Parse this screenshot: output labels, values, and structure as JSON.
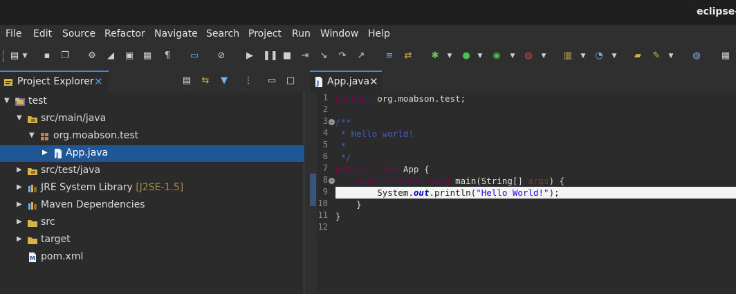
{
  "window": {
    "title": "eclipse-w"
  },
  "menu": [
    "File",
    "Edit",
    "Source",
    "Refactor",
    "Navigate",
    "Search",
    "Project",
    "Run",
    "Window",
    "Help"
  ],
  "toolbar_icons": [
    "new-icon",
    "save-icon",
    "save-all-icon",
    "properties-icon",
    "pencil-icon",
    "terminal-icon",
    "paragraph-icon",
    "toggle-icon",
    "skip-breakpoints-icon",
    "resume-icon",
    "suspend-icon",
    "terminate-icon",
    "step-into-icon",
    "step-over-icon",
    "step-return-icon",
    "drop-to-frame-icon",
    "debug-icon",
    "run-icon",
    "coverage-icon",
    "external-tools-icon",
    "new-java-project-icon",
    "new-class-icon",
    "open-type-icon",
    "search-icon",
    "globe-icon"
  ],
  "explorer": {
    "tab_label": "Project Explorer",
    "close": "✕",
    "tree": [
      {
        "label": "test",
        "decoration": ""
      },
      {
        "label": "src/main/java",
        "decoration": ""
      },
      {
        "label": "org.moabson.test",
        "decoration": ""
      },
      {
        "label": "App.java",
        "decoration": ""
      },
      {
        "label": "src/test/java",
        "decoration": ""
      },
      {
        "label": "JRE System Library ",
        "decoration": "[J2SE-1.5]"
      },
      {
        "label": "Maven Dependencies",
        "decoration": ""
      },
      {
        "label": "src",
        "decoration": ""
      },
      {
        "label": "target",
        "decoration": ""
      },
      {
        "label": "pom.xml",
        "decoration": ""
      }
    ]
  },
  "editor": {
    "tab_label": "App.java",
    "close": "✕",
    "line_numbers": [
      "1",
      "2",
      "3",
      "4",
      "5",
      "6",
      "7",
      "8",
      "9",
      "10",
      "11",
      "12"
    ],
    "code": [
      [
        {
          "t": "package",
          "c": "kw"
        },
        {
          "t": " org.moabson.test;",
          "c": ""
        }
      ],
      [],
      [
        {
          "t": "/**",
          "c": "cm"
        }
      ],
      [
        {
          "t": " * Hello world!",
          "c": "cm"
        }
      ],
      [
        {
          "t": " *",
          "c": "cm"
        }
      ],
      [
        {
          "t": " */",
          "c": "cm"
        }
      ],
      [
        {
          "t": "public",
          "c": "kw"
        },
        {
          "t": " ",
          "c": ""
        },
        {
          "t": "class",
          "c": "kw"
        },
        {
          "t": " App {",
          "c": ""
        }
      ],
      [
        {
          "t": "    ",
          "c": ""
        },
        {
          "t": "public",
          "c": "kw"
        },
        {
          "t": " ",
          "c": ""
        },
        {
          "t": "static",
          "c": "kw"
        },
        {
          "t": " ",
          "c": ""
        },
        {
          "t": "void",
          "c": "kw"
        },
        {
          "t": " main(String[] ",
          "c": ""
        },
        {
          "t": "args",
          "c": "par"
        },
        {
          "t": ") {",
          "c": ""
        }
      ],
      [
        {
          "t": "        System.",
          "c": ""
        },
        {
          "t": "out",
          "c": "fld"
        },
        {
          "t": ".println(",
          "c": ""
        },
        {
          "t": "\"Hello World!\"",
          "c": "st"
        },
        {
          "t": ");",
          "c": ""
        }
      ],
      [
        {
          "t": "    }",
          "c": ""
        }
      ],
      [
        {
          "t": "}",
          "c": ""
        }
      ],
      []
    ],
    "current_line": 9,
    "folding_lines": [
      3,
      8
    ]
  }
}
